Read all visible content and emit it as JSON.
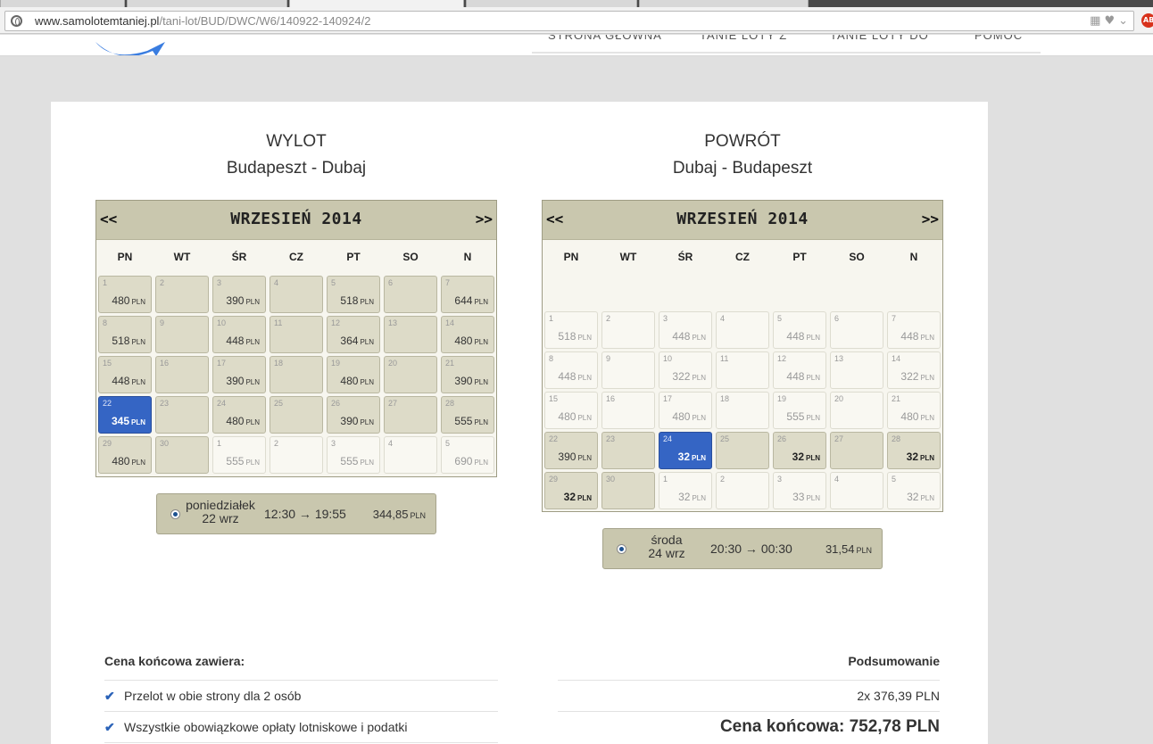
{
  "browser": {
    "url_domain": "www.samolotemtaniej.pl",
    "url_path": "/tani-lot/BUD/DWC/W6/140922-140924/2",
    "abp_label": "ABP"
  },
  "nav": {
    "items": [
      "STRONA GŁÓWNA",
      "TANIE LOTY Z",
      "TANIE LOTY DO",
      "POMOC"
    ]
  },
  "outbound": {
    "title": "WYLOT",
    "route": "Budapeszt - Dubaj",
    "month": "WRZESIEŃ 2014",
    "prev": "<<",
    "next": ">>",
    "weekdays": [
      "PN",
      "WT",
      "ŚR",
      "CZ",
      "PT",
      "SO",
      "N"
    ],
    "currency": "PLN",
    "days": [
      {
        "d": "1",
        "p": "480"
      },
      {
        "d": "2",
        "p": ""
      },
      {
        "d": "3",
        "p": "390"
      },
      {
        "d": "4",
        "p": ""
      },
      {
        "d": "5",
        "p": "518"
      },
      {
        "d": "6",
        "p": ""
      },
      {
        "d": "7",
        "p": "644"
      },
      {
        "d": "8",
        "p": "518"
      },
      {
        "d": "9",
        "p": ""
      },
      {
        "d": "10",
        "p": "448"
      },
      {
        "d": "11",
        "p": ""
      },
      {
        "d": "12",
        "p": "364"
      },
      {
        "d": "13",
        "p": ""
      },
      {
        "d": "14",
        "p": "480"
      },
      {
        "d": "15",
        "p": "448"
      },
      {
        "d": "16",
        "p": ""
      },
      {
        "d": "17",
        "p": "390"
      },
      {
        "d": "18",
        "p": ""
      },
      {
        "d": "19",
        "p": "480"
      },
      {
        "d": "20",
        "p": ""
      },
      {
        "d": "21",
        "p": "390"
      },
      {
        "d": "22",
        "p": "345",
        "selected": true
      },
      {
        "d": "23",
        "p": ""
      },
      {
        "d": "24",
        "p": "480"
      },
      {
        "d": "25",
        "p": ""
      },
      {
        "d": "26",
        "p": "390"
      },
      {
        "d": "27",
        "p": ""
      },
      {
        "d": "28",
        "p": "555"
      },
      {
        "d": "29",
        "p": "480"
      },
      {
        "d": "30",
        "p": ""
      },
      {
        "d": "1",
        "p": "555",
        "outside": true
      },
      {
        "d": "2",
        "p": "",
        "outside": true
      },
      {
        "d": "3",
        "p": "555",
        "outside": true
      },
      {
        "d": "4",
        "p": "",
        "outside": true
      },
      {
        "d": "5",
        "p": "690",
        "outside": true
      }
    ],
    "flight": {
      "day": "poniedziałek",
      "date": "22 wrz",
      "times": "12:30 → 19:55",
      "price": "344,85",
      "currency": "PLN"
    }
  },
  "return": {
    "title": "POWRÓT",
    "route": "Dubaj - Budapeszt",
    "month": "WRZESIEŃ 2014",
    "prev": "<<",
    "next": ">>",
    "weekdays": [
      "PN",
      "WT",
      "ŚR",
      "CZ",
      "PT",
      "SO",
      "N"
    ],
    "currency": "PLN",
    "days": [
      {
        "d": "1",
        "p": "518",
        "nofly": true
      },
      {
        "d": "2",
        "p": "",
        "nofly": true
      },
      {
        "d": "3",
        "p": "448",
        "nofly": true
      },
      {
        "d": "4",
        "p": "",
        "nofly": true
      },
      {
        "d": "5",
        "p": "448",
        "nofly": true
      },
      {
        "d": "6",
        "p": "",
        "nofly": true
      },
      {
        "d": "7",
        "p": "448",
        "nofly": true
      },
      {
        "d": "8",
        "p": "448",
        "nofly": true
      },
      {
        "d": "9",
        "p": "",
        "nofly": true
      },
      {
        "d": "10",
        "p": "322",
        "nofly": true
      },
      {
        "d": "11",
        "p": "",
        "nofly": true
      },
      {
        "d": "12",
        "p": "448",
        "nofly": true
      },
      {
        "d": "13",
        "p": "",
        "nofly": true
      },
      {
        "d": "14",
        "p": "322",
        "nofly": true
      },
      {
        "d": "15",
        "p": "480",
        "nofly": true
      },
      {
        "d": "16",
        "p": "",
        "nofly": true
      },
      {
        "d": "17",
        "p": "480",
        "nofly": true
      },
      {
        "d": "18",
        "p": "",
        "nofly": true
      },
      {
        "d": "19",
        "p": "555",
        "nofly": true
      },
      {
        "d": "20",
        "p": "",
        "nofly": true
      },
      {
        "d": "21",
        "p": "480",
        "nofly": true
      },
      {
        "d": "22",
        "p": "390"
      },
      {
        "d": "23",
        "p": ""
      },
      {
        "d": "24",
        "p": "32",
        "selected": true
      },
      {
        "d": "25",
        "p": ""
      },
      {
        "d": "26",
        "p": "32",
        "bold": true
      },
      {
        "d": "27",
        "p": ""
      },
      {
        "d": "28",
        "p": "32",
        "bold": true
      },
      {
        "d": "29",
        "p": "32",
        "bold": true
      },
      {
        "d": "30",
        "p": ""
      },
      {
        "d": "1",
        "p": "32",
        "outside": true
      },
      {
        "d": "2",
        "p": "",
        "outside": true
      },
      {
        "d": "3",
        "p": "33",
        "outside": true
      },
      {
        "d": "4",
        "p": "",
        "outside": true
      },
      {
        "d": "5",
        "p": "32",
        "outside": true
      }
    ],
    "flight": {
      "day": "środa",
      "date": "24 wrz",
      "times": "20:30 → 00:30",
      "price": "31,54",
      "currency": "PLN"
    }
  },
  "includes": {
    "heading": "Cena końcowa zawiera:",
    "items": [
      "Przelot w obie strony dla 2 osób",
      "Wszystkie obowiązkowe opłaty lotniskowe i podatki"
    ]
  },
  "summary": {
    "heading": "Podsumowanie",
    "line": "2x 376,39 PLN",
    "total": "Cena końcowa: 752,78 PLN"
  },
  "colors": {
    "accent": "#3565c4",
    "calendar_header": "#c9c7ae",
    "check": "#2a62b8"
  }
}
